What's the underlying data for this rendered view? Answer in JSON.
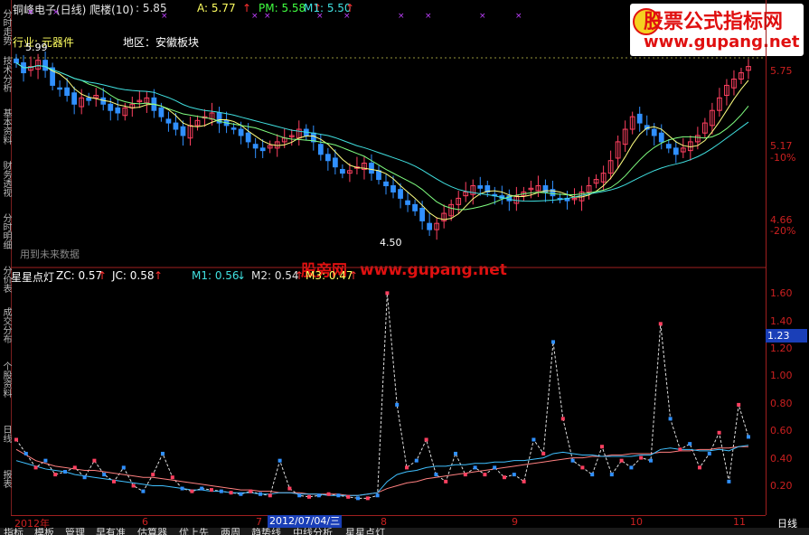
{
  "window": {
    "title": "铜峰电子(日线) 爬楼(10)"
  },
  "price_header": {
    "v1": ": 5.85",
    "a": "A: 5.77",
    "pm": "PM: 5.58",
    "m1": "M1: 5.50"
  },
  "industry": {
    "label": "行业:",
    "name": "元器件",
    "region": "地区：安徽板块"
  },
  "annotations": {
    "high": "5.99",
    "low": "4.50",
    "future_note": "用到未来数据"
  },
  "indicator_header": {
    "title": "星星点灯",
    "zc": "ZC: 0.57",
    "jc": "JC: 0.58",
    "m1": "M1: 0.56",
    "m2": "M2: 0.54",
    "m3": "M3: 0.47"
  },
  "right_axis": {
    "price": [
      "5.75",
      "5.17",
      "-10%",
      "4.66",
      "-20%"
    ],
    "indicator": [
      "1.60",
      "1.40",
      "1.20",
      "1.00",
      "0.80",
      "0.60",
      "0.40",
      "0.20"
    ],
    "current": "1.23"
  },
  "date_axis": {
    "ticks": [
      "2012年",
      "6",
      "7",
      "8",
      "9",
      "10",
      "11"
    ],
    "selected": "2012/07/04/三",
    "period": "日线"
  },
  "left_tabs": [
    "分时走势",
    "技术分析",
    "基本资料",
    "财务透视",
    "分时明细",
    "分价表",
    "成交分布",
    "个股资料",
    "日线",
    "报表"
  ],
  "bottom_tabs": [
    "指标",
    "模板",
    "管理",
    "早有准",
    "估算器",
    "优上先",
    "两周",
    "趋势线",
    "中线分析",
    "星星点灯"
  ],
  "watermark": {
    "title": "股票公式指标网",
    "url": "www.gupang.net",
    "mid_title": "股旁网",
    "mid_url": "www.gupang.net"
  },
  "colors": {
    "up": "#ff4060",
    "down": "#3090ff",
    "axis": "#a01f1f",
    "ma1": "#ffff80",
    "ma2": "#80ff80",
    "ma3": "#40e0e0"
  },
  "chart_data": [
    {
      "type": "candlestick",
      "title": "铜峰电子(日线)",
      "yaxis_labels": [
        "5.75",
        "5.17",
        "4.66"
      ],
      "high": 5.99,
      "low": 4.5,
      "close": [
        5.88,
        5.8,
        5.85,
        5.9,
        5.82,
        5.7,
        5.68,
        5.62,
        5.55,
        5.6,
        5.58,
        5.62,
        5.55,
        5.5,
        5.48,
        5.52,
        5.55,
        5.58,
        5.6,
        5.5,
        5.45,
        5.4,
        5.35,
        5.3,
        5.38,
        5.42,
        5.45,
        5.48,
        5.4,
        5.38,
        5.35,
        5.3,
        5.25,
        5.2,
        5.18,
        5.22,
        5.25,
        5.28,
        5.3,
        5.35,
        5.3,
        5.25,
        5.15,
        5.1,
        5.05,
        5.0,
        5.02,
        5.05,
        5.08,
        5.0,
        4.95,
        4.9,
        4.85,
        4.8,
        4.75,
        4.7,
        4.62,
        4.55,
        4.6,
        4.68,
        4.75,
        4.8,
        4.85,
        4.9,
        4.88,
        4.85,
        4.82,
        4.8,
        4.78,
        4.82,
        4.85,
        4.88,
        4.9,
        4.85,
        4.82,
        4.8,
        4.78,
        4.8,
        4.85,
        4.9,
        4.95,
        5.0,
        5.1,
        5.25,
        5.35,
        5.45,
        5.4,
        5.35,
        5.3,
        5.25,
        5.2,
        5.15,
        5.2,
        5.25,
        5.3,
        5.4,
        5.5,
        5.6,
        5.7,
        5.75,
        5.8,
        5.85
      ]
    },
    {
      "type": "line",
      "title": "星星点灯",
      "yaxis_labels": [
        "1.60",
        "1.40",
        "1.20",
        "1.00",
        "0.80",
        "0.60",
        "0.40",
        "0.20"
      ],
      "series": [
        {
          "name": "ZC",
          "values": [
            0.55,
            0.45,
            0.35,
            0.4,
            0.3,
            0.32,
            0.35,
            0.28,
            0.4,
            0.3,
            0.25,
            0.35,
            0.22,
            0.18,
            0.3,
            0.45,
            0.28,
            0.2,
            0.18,
            0.2,
            0.19,
            0.18,
            0.17,
            0.16,
            0.18,
            0.16,
            0.15,
            0.4,
            0.2,
            0.15,
            0.14,
            0.15,
            0.16,
            0.15,
            0.14,
            0.13,
            0.13,
            0.15,
            1.6,
            0.8,
            0.35,
            0.4,
            0.55,
            0.3,
            0.25,
            0.45,
            0.3,
            0.35,
            0.3,
            0.35,
            0.28,
            0.3,
            0.25,
            0.55,
            0.45,
            1.25,
            0.7,
            0.4,
            0.35,
            0.3,
            0.5,
            0.3,
            0.4,
            0.35,
            0.42,
            0.4,
            1.38,
            0.7,
            0.48,
            0.52,
            0.35,
            0.45,
            0.6,
            0.25,
            0.8,
            0.57
          ]
        },
        {
          "name": "JC",
          "values": [
            0.48,
            0.44,
            0.4,
            0.38,
            0.36,
            0.35,
            0.34,
            0.33,
            0.33,
            0.32,
            0.31,
            0.3,
            0.29,
            0.28,
            0.28,
            0.27,
            0.26,
            0.25,
            0.24,
            0.23,
            0.22,
            0.21,
            0.2,
            0.19,
            0.19,
            0.18,
            0.18,
            0.17,
            0.17,
            0.17,
            0.16,
            0.16,
            0.16,
            0.16,
            0.15,
            0.15,
            0.16,
            0.17,
            0.2,
            0.22,
            0.24,
            0.25,
            0.27,
            0.28,
            0.29,
            0.3,
            0.31,
            0.32,
            0.33,
            0.34,
            0.35,
            0.36,
            0.37,
            0.38,
            0.39,
            0.4,
            0.41,
            0.42,
            0.42,
            0.43,
            0.43,
            0.44,
            0.44,
            0.45,
            0.45,
            0.45,
            0.46,
            0.46,
            0.47,
            0.47,
            0.48,
            0.48,
            0.49,
            0.49,
            0.5,
            0.5
          ]
        },
        {
          "name": "M1",
          "values": [
            0.4,
            0.38,
            0.36,
            0.34,
            0.33,
            0.32,
            0.3,
            0.29,
            0.28,
            0.27,
            0.26,
            0.25,
            0.24,
            0.23,
            0.22,
            0.22,
            0.21,
            0.2,
            0.19,
            0.19,
            0.18,
            0.18,
            0.17,
            0.17,
            0.17,
            0.16,
            0.16,
            0.17,
            0.17,
            0.16,
            0.16,
            0.16,
            0.15,
            0.15,
            0.15,
            0.15,
            0.16,
            0.17,
            0.25,
            0.3,
            0.32,
            0.33,
            0.35,
            0.36,
            0.36,
            0.37,
            0.37,
            0.38,
            0.38,
            0.39,
            0.39,
            0.4,
            0.4,
            0.41,
            0.42,
            0.45,
            0.46,
            0.45,
            0.44,
            0.44,
            0.43,
            0.43,
            0.43,
            0.43,
            0.44,
            0.44,
            0.48,
            0.49,
            0.48,
            0.48,
            0.47,
            0.47,
            0.48,
            0.47,
            0.5,
            0.51
          ]
        }
      ]
    }
  ]
}
